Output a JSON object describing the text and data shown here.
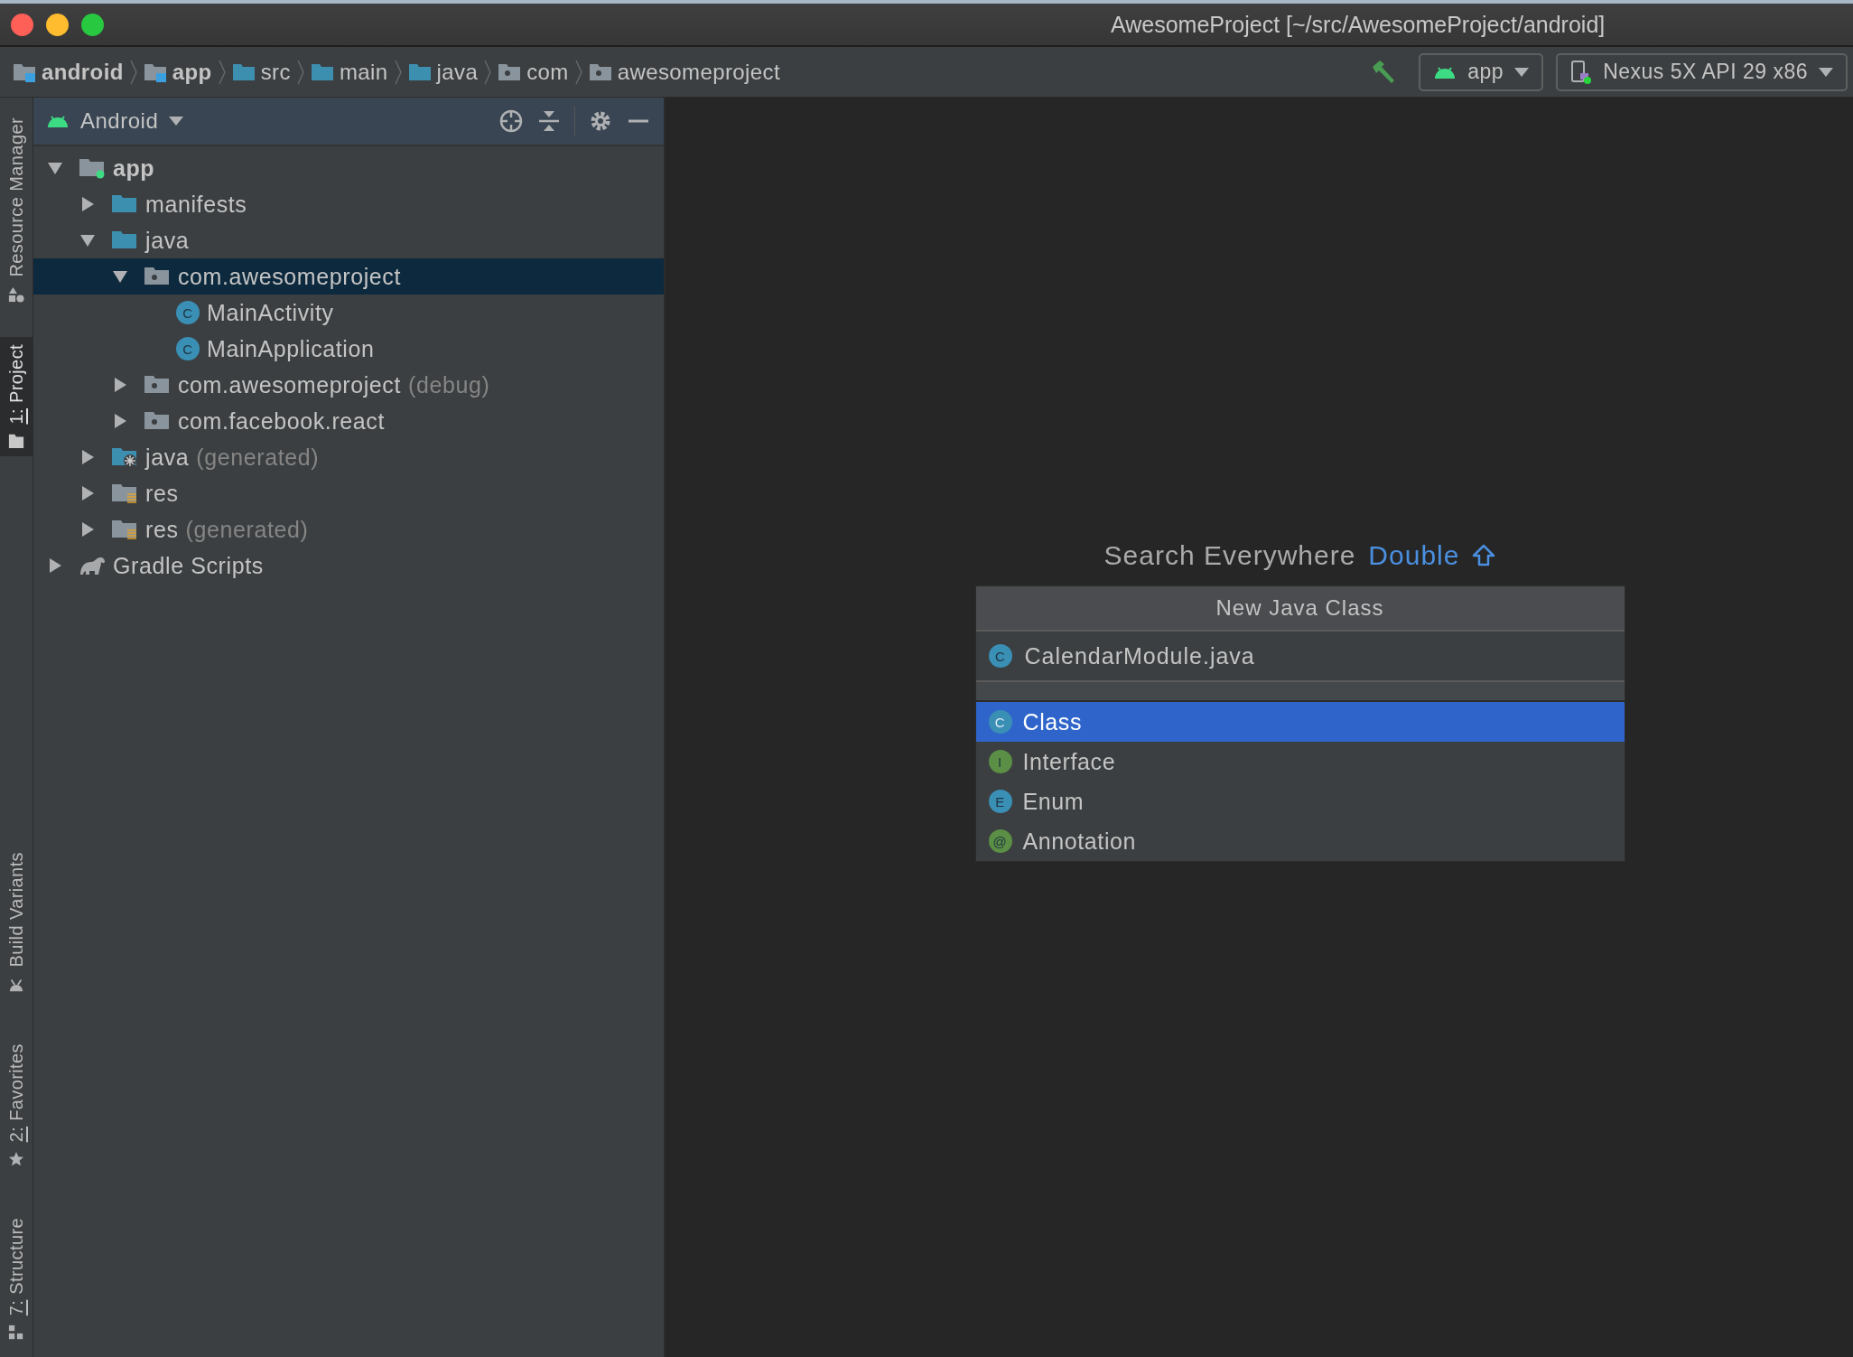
{
  "window": {
    "title": "AwesomeProject [~/src/AwesomeProject/android]"
  },
  "breadcrumbs": [
    {
      "label": "android",
      "kind": "module"
    },
    {
      "label": "app",
      "kind": "module"
    },
    {
      "label": "src",
      "kind": "folder"
    },
    {
      "label": "main",
      "kind": "folder"
    },
    {
      "label": "java",
      "kind": "source"
    },
    {
      "label": "com",
      "kind": "package"
    },
    {
      "label": "awesomeproject",
      "kind": "package"
    }
  ],
  "toolbar": {
    "run_config": "app",
    "device": "Nexus 5X API 29 x86"
  },
  "side_tabs": {
    "top": [
      {
        "label": "Resource Manager",
        "kind": "resources",
        "mnemonic": false,
        "selected": false
      },
      {
        "label": "1: Project",
        "kind": "project",
        "mnemonic": true,
        "selected": true
      }
    ],
    "bottom": [
      {
        "label": "Build Variants",
        "kind": "variants",
        "mnemonic": false,
        "selected": false
      },
      {
        "label": "2: Favorites",
        "kind": "favorites",
        "mnemonic": true,
        "selected": false
      },
      {
        "label": "7: Structure",
        "kind": "structure",
        "mnemonic": true,
        "selected": false
      }
    ]
  },
  "project_panel": {
    "view": "Android",
    "tree": [
      {
        "label": "app",
        "kind": "module",
        "expanded": true,
        "selected": false,
        "children": [
          {
            "label": "manifests",
            "kind": "folder",
            "expanded": false,
            "selected": false
          },
          {
            "label": "java",
            "kind": "folder",
            "expanded": true,
            "selected": false,
            "children": [
              {
                "label": "com.awesomeproject",
                "kind": "package",
                "expanded": true,
                "selected": true,
                "children": [
                  {
                    "label": "MainActivity",
                    "kind": "class",
                    "icon_letter": "C",
                    "selected": false
                  },
                  {
                    "label": "MainApplication",
                    "kind": "class",
                    "icon_letter": "C",
                    "selected": false
                  }
                ]
              },
              {
                "label": "com.awesomeproject",
                "suffix": "(debug)",
                "kind": "package",
                "expanded": false,
                "selected": false
              },
              {
                "label": "com.facebook.react",
                "kind": "package",
                "expanded": false,
                "selected": false
              }
            ]
          },
          {
            "label": "java",
            "suffix": "(generated)",
            "kind": "generated",
            "expanded": false,
            "selected": false
          },
          {
            "label": "res",
            "kind": "res",
            "expanded": false,
            "selected": false
          },
          {
            "label": "res",
            "suffix": "(generated)",
            "kind": "res",
            "expanded": false,
            "selected": false
          }
        ]
      },
      {
        "label": "Gradle Scripts",
        "kind": "gradle",
        "expanded": false,
        "selected": false
      }
    ]
  },
  "editor": {
    "hint": "Search Everywhere",
    "shortcut": "Double"
  },
  "popup": {
    "title": "New Java Class",
    "name_field": {
      "value": "CalendarModule.java",
      "icon_letter": "C"
    },
    "options": [
      {
        "label": "Class",
        "kind": "class",
        "icon_letter": "C",
        "selected": true
      },
      {
        "label": "Interface",
        "kind": "interface",
        "icon_letter": "I",
        "selected": false
      },
      {
        "label": "Enum",
        "kind": "enum",
        "icon_letter": "E",
        "selected": false
      },
      {
        "label": "Annotation",
        "kind": "annotation",
        "icon_letter": "@",
        "selected": false
      }
    ]
  }
}
